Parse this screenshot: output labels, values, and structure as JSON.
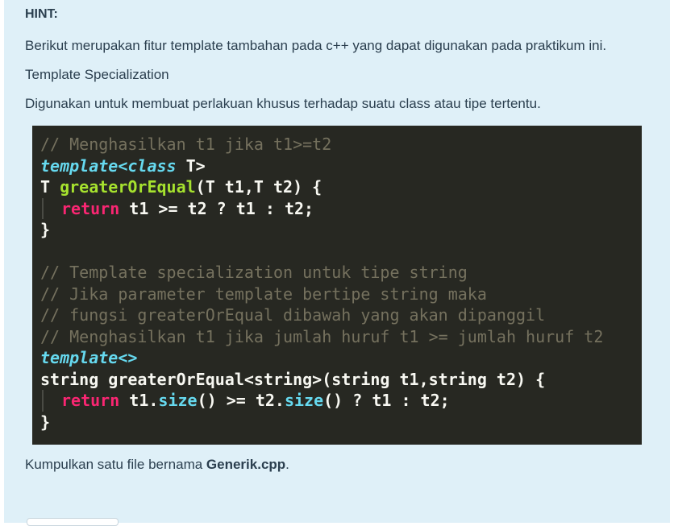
{
  "hint": {
    "title": "HINT:",
    "paragraph1": "Berikut merupakan fitur template tambahan pada c++ yang dapat digunakan pada praktikum ini.",
    "paragraph2": "Template Specialization",
    "paragraph3": "Digunakan untuk membuat perlakuan khusus terhadap suatu class atau tipe tertentu.",
    "final_prefix": "Kumpulkan satu file bernama ",
    "final_file": "Generik.cpp",
    "final_suffix": "."
  },
  "code": {
    "l1": "// Menghasilkan t1 jika t1>=t2",
    "l2_kw": "template",
    "l2_lt": "<",
    "l2_class": "class",
    "l2_rest": " T>",
    "l3_a": "T ",
    "l3_fn": "greaterOrEqual",
    "l3_b": "(T t1,T t2) {",
    "l4_ret": "return",
    "l4_rest": " t1 >= t2 ? t1 : t2;",
    "l5": "}",
    "l6": "",
    "l7": "// Template specialization untuk tipe string",
    "l8": "// Jika parameter template bertipe string maka",
    "l9": "// fungsi greaterOrEqual dibawah yang akan dipanggil",
    "l10": "// Menghasilkan t1 jika jumlah huruf t1 >= jumlah huruf t2",
    "l11_kw": "template",
    "l11_rest": "<>",
    "l12": "string greaterOrEqual<string>(string t1,string t2) {",
    "l13_ret": "return",
    "l13_a": " t1.",
    "l13_size1": "size",
    "l13_b": "() >= t2.",
    "l13_size2": "size",
    "l13_c": "() ? t1 : t2;",
    "l14": "}"
  },
  "colors": {
    "panel_bg": "#dff0f8",
    "code_bg": "#272822",
    "comment": "#75715e",
    "keyword": "#66d9ef",
    "return": "#f92672",
    "function": "#a6e22e"
  }
}
